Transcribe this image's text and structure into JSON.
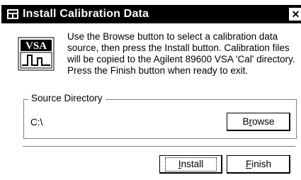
{
  "window": {
    "title": "Install Calibration Data",
    "close_glyph": "✕"
  },
  "logo": {
    "text": "VSA",
    "icon": "vsa-app-logo"
  },
  "message": "Use the Browse button to select a calibration data source, then press the Install button.  Calibration files will be copied to the Agilent 89600 VSA 'Cal' directory.  Press the Finish button when ready to exit.",
  "source_directory": {
    "label": "Source Directory",
    "value": "C:\\"
  },
  "buttons": {
    "browse": {
      "pre": "B",
      "accel": "r",
      "post": "owse"
    },
    "install": {
      "pre": "",
      "accel": "I",
      "post": "nstall"
    },
    "finish": {
      "pre": "",
      "accel": "F",
      "post": "inish"
    }
  }
}
